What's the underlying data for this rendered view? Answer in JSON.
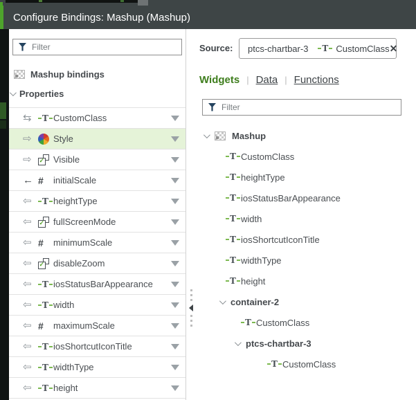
{
  "dialog": {
    "title": "Configure Bindings: Mashup (Mashup)"
  },
  "colors": {
    "accent_green": "#4ea32c",
    "header_bg": "#3e4546",
    "selection_green": "#e5f3d8",
    "active_tab_green": "#3f7e1e"
  },
  "left_panel": {
    "filter_placeholder": "Filter",
    "filter_icon": "funnel-icon",
    "bindings_label": "Mashup bindings",
    "bindings_icon": "mashup-icon",
    "section_label": "Properties",
    "properties": [
      {
        "label": "CustomClass",
        "direction": "both",
        "type": "string",
        "selected": false
      },
      {
        "label": "Style",
        "direction": "out",
        "type": "style",
        "selected": true
      },
      {
        "label": "Visible",
        "direction": "out",
        "type": "boolean",
        "selected": false
      },
      {
        "label": "initialScale",
        "direction": "in",
        "bound": true,
        "type": "number",
        "selected": false
      },
      {
        "label": "heightType",
        "direction": "in",
        "type": "string",
        "selected": false
      },
      {
        "label": "fullScreenMode",
        "direction": "in",
        "type": "boolean",
        "selected": false
      },
      {
        "label": "minimumScale",
        "direction": "in",
        "type": "number",
        "selected": false
      },
      {
        "label": "disableZoom",
        "direction": "in",
        "type": "boolean",
        "selected": false
      },
      {
        "label": "iosStatusBarAppearance",
        "direction": "in",
        "type": "string",
        "selected": false
      },
      {
        "label": "width",
        "direction": "in",
        "type": "string",
        "selected": false
      },
      {
        "label": "maximumScale",
        "direction": "in",
        "type": "number",
        "selected": false
      },
      {
        "label": "iosShortcutIconTitle",
        "direction": "in",
        "type": "string",
        "selected": false
      },
      {
        "label": "widthType",
        "direction": "in",
        "type": "string",
        "selected": false
      },
      {
        "label": "height",
        "direction": "in",
        "type": "string",
        "selected": false
      }
    ]
  },
  "right_panel": {
    "source_label": "Source:",
    "source_chip": {
      "widget": "ptcs-chartbar-3",
      "widget_icon": "bar-chart-icon",
      "property": "CustomClass",
      "property_icon": "text-type-icon",
      "remove_icon": "close-icon"
    },
    "tabs": [
      {
        "label": "Widgets",
        "active": true
      },
      {
        "label": "Data",
        "active": false
      },
      {
        "label": "Functions",
        "active": false
      }
    ],
    "filter_placeholder": "Filter",
    "tree": [
      {
        "label": "Mashup",
        "level": 0,
        "bold": true,
        "expanded": true,
        "icon": "mashup-icon",
        "selected": false
      },
      {
        "label": "CustomClass",
        "level": 1,
        "bold": false,
        "type": "string",
        "selected": false
      },
      {
        "label": "heightType",
        "level": 1,
        "bold": false,
        "type": "string",
        "selected": false
      },
      {
        "label": "iosStatusBarAppearance",
        "level": 1,
        "bold": false,
        "type": "string",
        "selected": false
      },
      {
        "label": "width",
        "level": 1,
        "bold": false,
        "type": "string",
        "selected": false
      },
      {
        "label": "iosShortcutIconTitle",
        "level": 1,
        "bold": false,
        "type": "string",
        "selected": false
      },
      {
        "label": "widthType",
        "level": 1,
        "bold": false,
        "type": "string",
        "selected": false
      },
      {
        "label": "height",
        "level": 1,
        "bold": false,
        "type": "string",
        "selected": false
      },
      {
        "label": "container-2",
        "level": 1,
        "bold": true,
        "expanded": true,
        "selected": false
      },
      {
        "label": "CustomClass",
        "level": 2,
        "bold": false,
        "type": "string",
        "selected": false
      },
      {
        "label": "ptcs-chartbar-3",
        "level": 2,
        "bold": true,
        "expanded": true,
        "selected": false
      },
      {
        "label": "CustomClass",
        "level": 3,
        "bold": false,
        "type": "string",
        "selected": true
      }
    ]
  }
}
